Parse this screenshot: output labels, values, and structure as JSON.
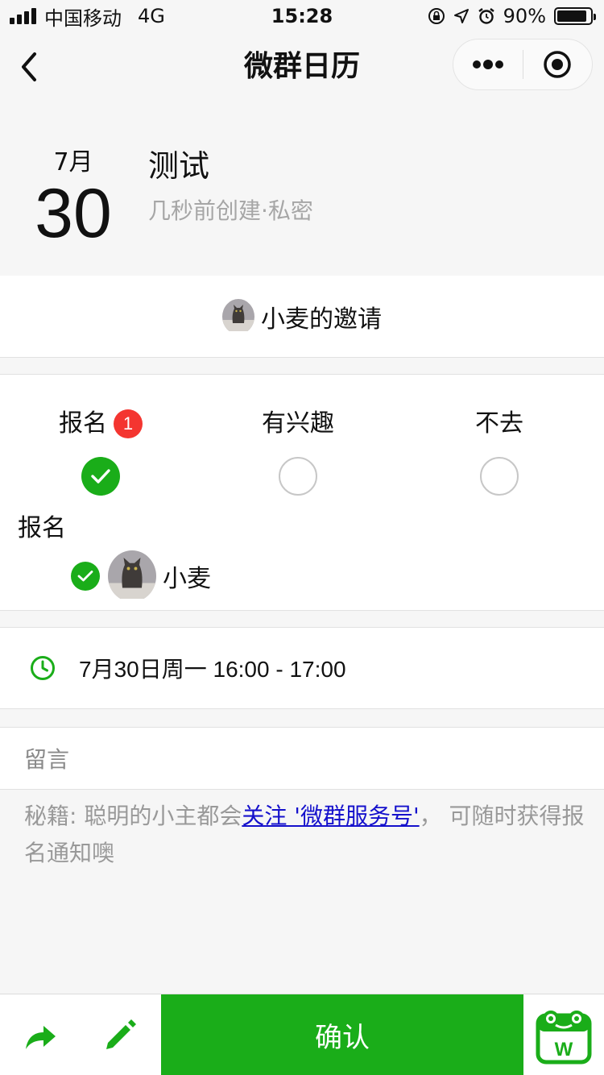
{
  "status": {
    "carrier": "中国移动",
    "network": "4G",
    "time": "15:28",
    "battery": "90%",
    "battery_level": 0.9
  },
  "nav": {
    "title": "微群日历"
  },
  "event": {
    "month": "7月",
    "day": "30",
    "title": "测试",
    "meta": "几秒前创建·私密"
  },
  "invite": {
    "text": "小麦的邀请"
  },
  "rsvp": {
    "options": [
      {
        "label": "报名",
        "badge": "1",
        "checked": true
      },
      {
        "label": "有兴趣",
        "checked": false
      },
      {
        "label": "不去",
        "checked": false
      }
    ],
    "section_heading": "报名",
    "attendees": [
      {
        "name": "小麦"
      }
    ]
  },
  "time": {
    "text": "7月30日周一 16:00 - 17:00"
  },
  "comment": {
    "label": "留言"
  },
  "tip": {
    "prefix": "秘籍: 聪明的小主都会",
    "link": "关注 '微群服务号'",
    "suffix": "， 可随时获得报名通知噢"
  },
  "bottom": {
    "confirm_label": "确认",
    "logo_letter": "W"
  },
  "colors": {
    "green": "#1aad19",
    "badge_red": "#f43530",
    "link_blue": "#1511cc",
    "muted": "#a6a6a6"
  }
}
